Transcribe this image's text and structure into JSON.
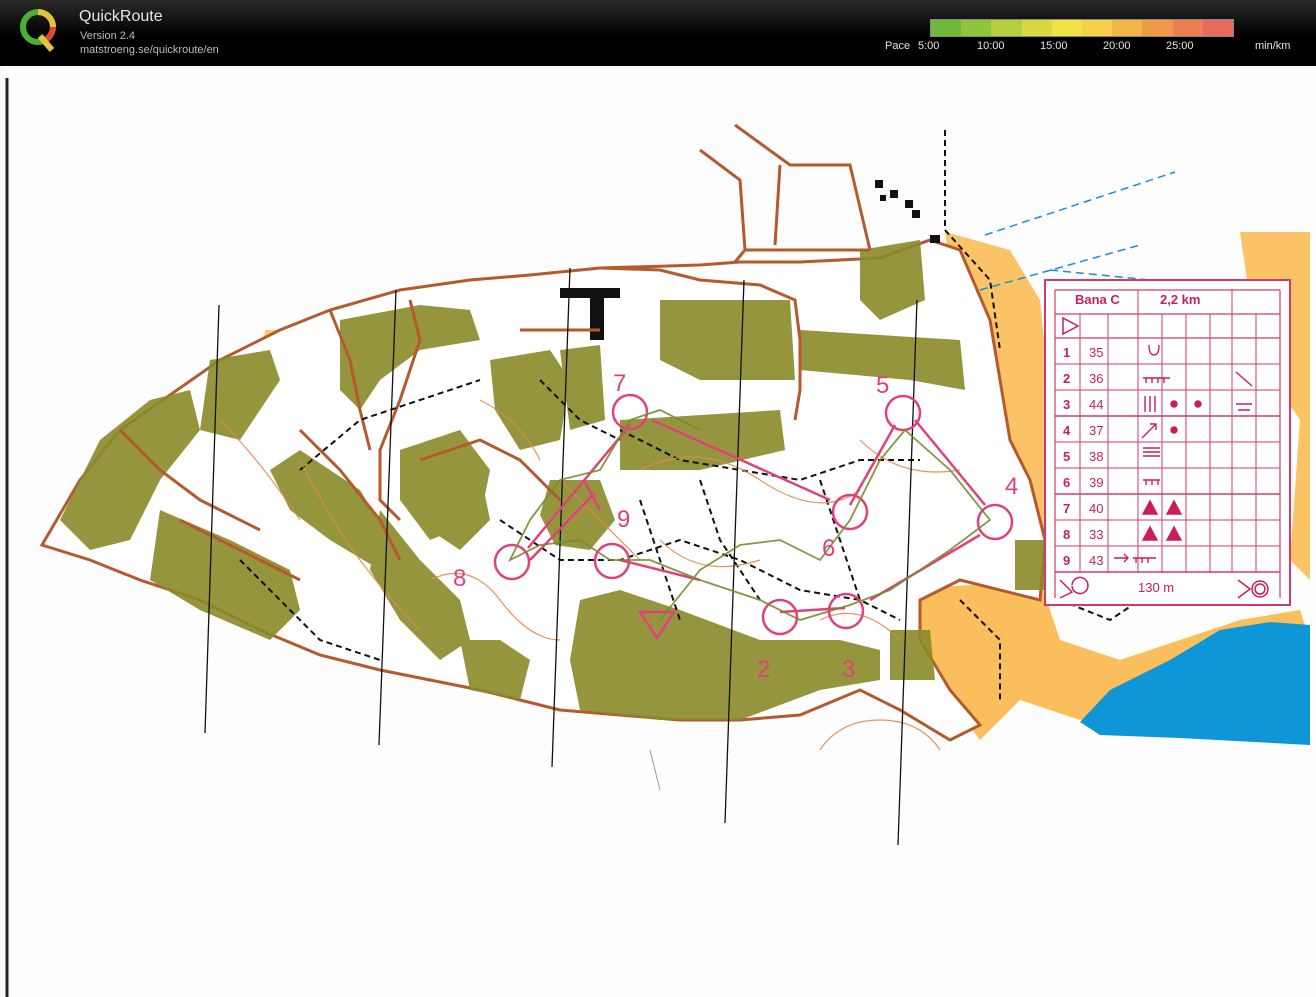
{
  "app": {
    "title": "QuickRoute",
    "version": "Version 2.4",
    "url": "matstroeng.se/quickroute/en",
    "logo_letter": "Q"
  },
  "pace_legend": {
    "label": "Pace",
    "ticks": [
      "5:00",
      "10:00",
      "15:00",
      "20:00",
      "25:00"
    ],
    "unit": "min/km",
    "colors": [
      "#6fb83a",
      "#8fc43c",
      "#b6cf3e",
      "#d8d842",
      "#f2e347",
      "#f5d049",
      "#f3b748",
      "#f09a49",
      "#ec7f4f",
      "#e86a5a"
    ]
  },
  "map": {
    "controls": [
      "2",
      "3",
      "4",
      "5",
      "6",
      "7",
      "8",
      "9"
    ],
    "control_card": {
      "course": "Bana C",
      "length": "2,2 km",
      "rows": [
        {
          "num": "1",
          "code": "35"
        },
        {
          "num": "2",
          "code": "36"
        },
        {
          "num": "3",
          "code": "44"
        },
        {
          "num": "4",
          "code": "37"
        },
        {
          "num": "5",
          "code": "38"
        },
        {
          "num": "6",
          "code": "39"
        },
        {
          "num": "7",
          "code": "40"
        },
        {
          "num": "8",
          "code": "33"
        },
        {
          "num": "9",
          "code": "43"
        }
      ],
      "finish_distance": "130 m"
    },
    "colors": {
      "course": "#e0407c",
      "urban": "#8a8a2a",
      "open": "#f7a93a",
      "water": "#0e96d6",
      "road": "#b45a2c"
    }
  }
}
